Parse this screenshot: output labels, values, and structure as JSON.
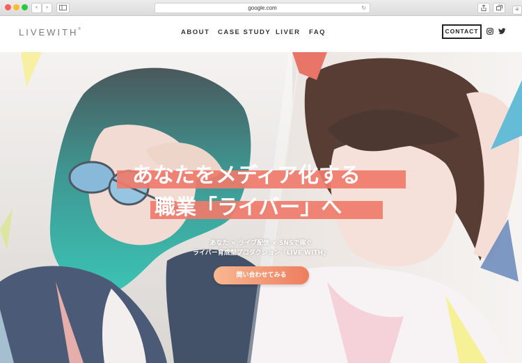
{
  "browser": {
    "url": "google.com",
    "back_glyph": "‹",
    "forward_glyph": "›",
    "reload_glyph": "↻"
  },
  "header": {
    "logo_text": "LIVEWITH",
    "logo_mark": "®",
    "nav": [
      "ABOUT",
      "CASE STUDY",
      "LIVER",
      "FAQ"
    ],
    "contact_label": "CONTACT",
    "social_icons": [
      "instagram-icon",
      "twitter-icon"
    ]
  },
  "hero": {
    "headline_line1": "あなたをメディア化する",
    "headline_line2": "職業「ライバー」へ",
    "subtitle_line1": "あなた × ライブ配信 × SNSで稼ぐ",
    "subtitle_line2": "ライバー育成型プロダクション「LIVE WITH」",
    "cta_label": "問い合わせてみる"
  },
  "colors": {
    "accent_band": "#ef7b6b",
    "cta_start": "#f8b890",
    "cta_end": "#ee7d5f",
    "teal_hair": "#2cc0b0"
  }
}
